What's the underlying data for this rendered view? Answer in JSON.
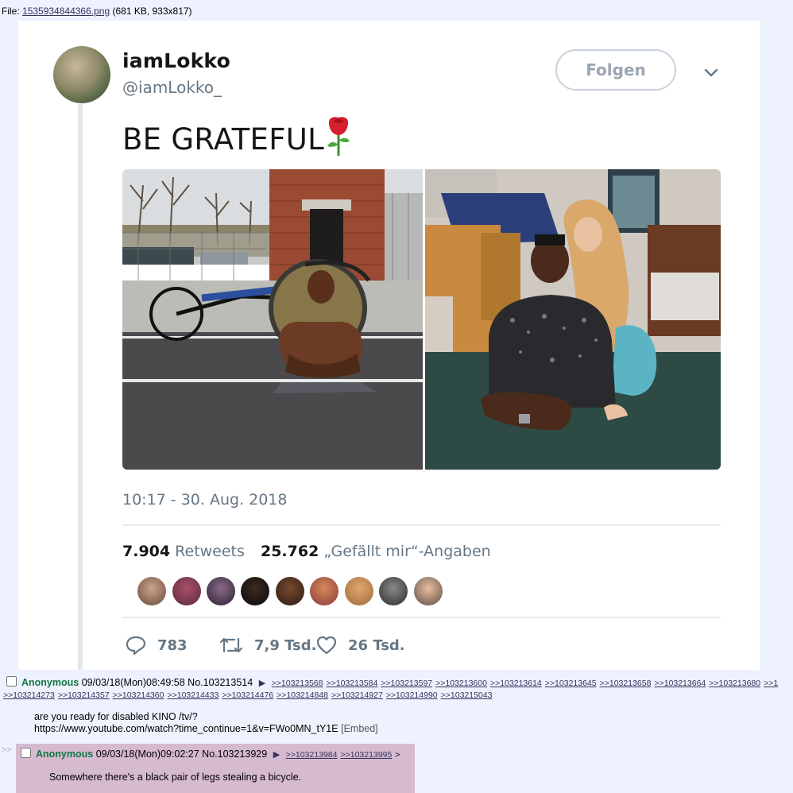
{
  "file": {
    "prefix": "File:",
    "name": "1535934844366.png",
    "meta": "(681 KB, 933x817)"
  },
  "tweet": {
    "display_name": "iamLokko",
    "handle": "@iamLokko_",
    "follow_label": "Folgen",
    "text": "BE GRATEFUL",
    "timestamp": "10:17 - 30. Aug. 2018",
    "retweets_count": "7.904",
    "retweets_label": "Retweets",
    "likes_count": "25.762",
    "likes_label": "„Gefällt mir“-Angaben",
    "replies": "783",
    "retweets_short": "7,9 Tsd.",
    "likes_short": "26 Tsd."
  },
  "post": {
    "name": "Anonymous",
    "datetime": "09/03/18(Mon)08:49:58",
    "number": "No.103213514",
    "backlinks_row1": [
      ">>103213568",
      ">>103213584",
      ">>103213597",
      ">>103213600",
      ">>103213614",
      ">>103213645",
      ">>103213658",
      ">>103213664",
      ">>103213680",
      ">>1"
    ],
    "backlinks_row2": [
      ">>103214273",
      ">>103214357",
      ">>103214360",
      ">>103214433",
      ">>103214476",
      ">>103214848",
      ">>103214927",
      ">>103214990",
      ">>103215043"
    ],
    "line1": "are you ready for disabled KINO /tv/?",
    "line2": "https://www.youtube.com/watch?time_continue=1&v=FWo0MN_tY1E",
    "embed": "[Embed]"
  },
  "reply": {
    "arrows": ">>",
    "name": "Anonymous",
    "datetime": "09/03/18(Mon)09:02:27",
    "number": "No.103213929",
    "backlinks": [
      ">>103213984",
      ">>103213995"
    ],
    "trail": ">",
    "text": "Somewhere there's a black pair of legs stealing a bicycle."
  }
}
